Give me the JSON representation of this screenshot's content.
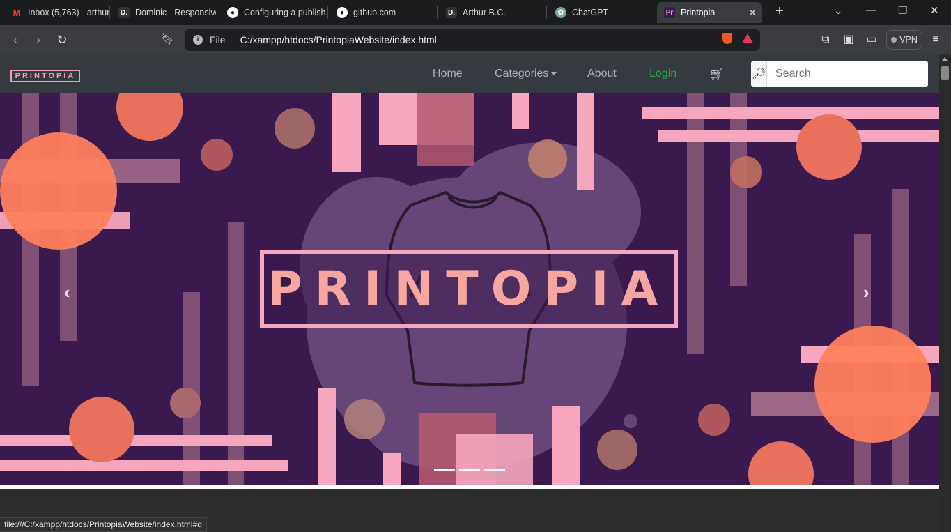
{
  "tabs": [
    {
      "title": "Inbox (5,763) - arthur",
      "icon": "gmail-icon"
    },
    {
      "title": "Dominic - Responsive",
      "icon": "dev-icon"
    },
    {
      "title": "Configuring a publish",
      "icon": "github-icon"
    },
    {
      "title": "github.com",
      "icon": "github-icon"
    },
    {
      "title": "Arthur B.C.",
      "icon": "dev-icon"
    },
    {
      "title": "ChatGPT",
      "icon": "chatgpt-icon"
    },
    {
      "title": "Printopia",
      "icon": "printopia-icon"
    }
  ],
  "address": {
    "scheme_label": "File",
    "url": "C:/xampp/htdocs/PrintopiaWebsite/index.html",
    "vpn_label": "VPN"
  },
  "site": {
    "brand": "PRINTOPIA",
    "nav": {
      "home": "Home",
      "categories": "Categories",
      "about": "About",
      "login": "Login"
    },
    "search_placeholder": "Search",
    "hero_title": "PRINTOPIA",
    "carousel_slides": 3,
    "carousel_active": 1
  },
  "status_url": "file:///C:/xampp/htdocs/PrintopiaWebsite/index.html#d",
  "colors": {
    "hero_bg": "#3a1a4e",
    "accent_pink": "#f7a8c1",
    "accent_coral": "#ff7f5b",
    "login_green": "#28a745",
    "navbar_bg": "#343a40"
  }
}
